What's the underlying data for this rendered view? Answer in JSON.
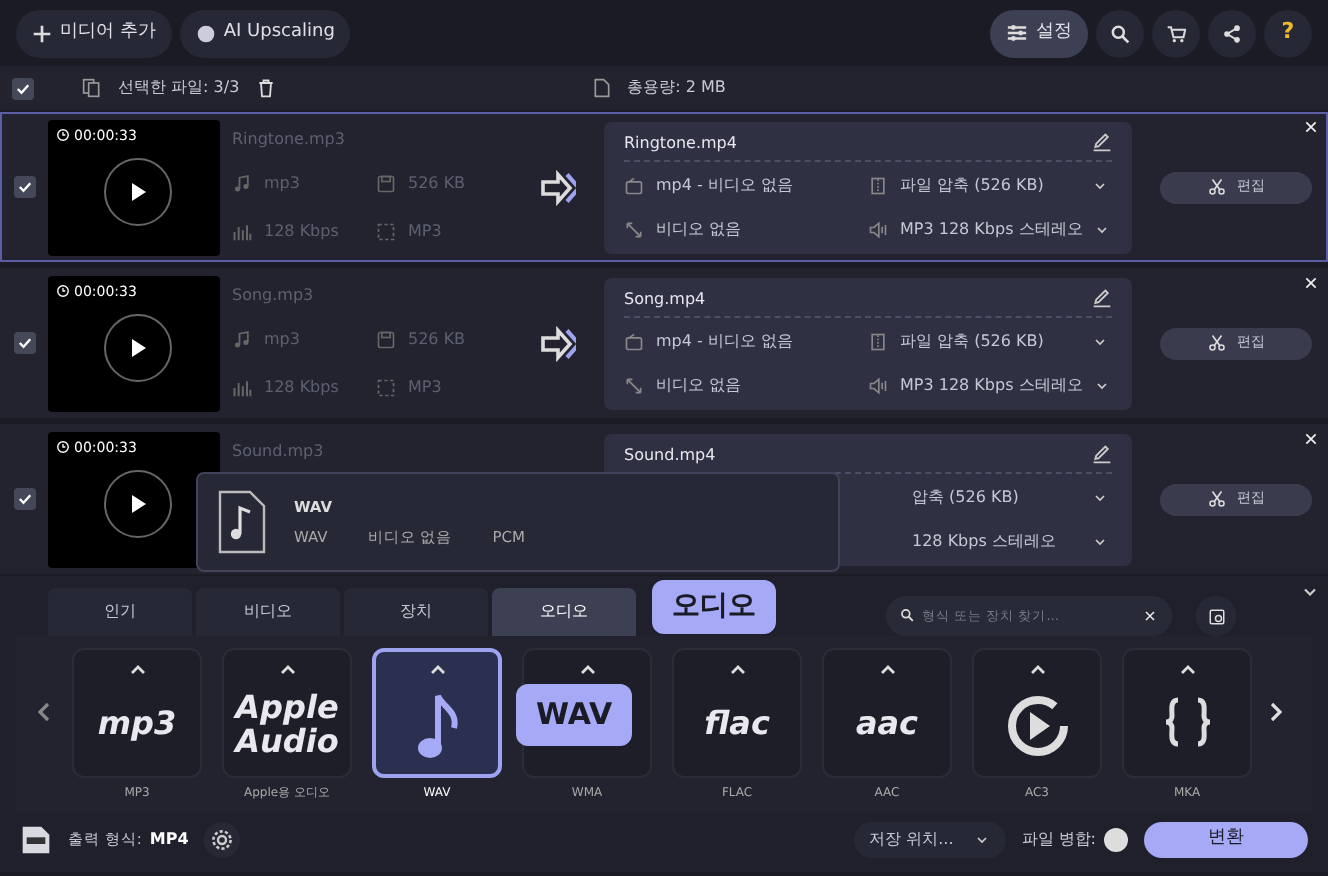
{
  "toolbar": {
    "add_media": "미디어 추가",
    "ai_upscaling": "AI Upscaling",
    "settings": "설정",
    "settings_selected": true,
    "help": "?"
  },
  "selection": {
    "checked": true,
    "selected_files": "선택한 파일: 3/3",
    "total_size": "총용량: 2 MB"
  },
  "files": [
    {
      "checked": true,
      "selected": true,
      "duration": "00:00:33",
      "source": {
        "name": "Ringtone.mp3",
        "format": "mp3",
        "size": "526 KB",
        "bitrate": "128 Kbps",
        "codec": "MP3"
      },
      "output": {
        "name": "Ringtone.mp4",
        "fields": [
          {
            "kind": "container",
            "text": "mp4 - 비디오 없음"
          },
          {
            "kind": "compression",
            "text": "파일 압축 (526 KB)"
          },
          {
            "kind": "video",
            "text": "비디오 없음"
          },
          {
            "kind": "audio",
            "text": "MP3 128 Kbps 스테레오"
          }
        ]
      },
      "edit": "편집"
    },
    {
      "checked": true,
      "selected": false,
      "duration": "00:00:33",
      "source": {
        "name": "Song.mp3",
        "format": "mp3",
        "size": "526 KB",
        "bitrate": "128 Kbps",
        "codec": "MP3"
      },
      "output": {
        "name": "Song.mp4",
        "fields": [
          {
            "kind": "container",
            "text": "mp4 - 비디오 없음"
          },
          {
            "kind": "compression",
            "text": "파일 압축 (526 KB)"
          },
          {
            "kind": "video",
            "text": "비디오 없음"
          },
          {
            "kind": "audio",
            "text": "MP3 128 Kbps 스테레오"
          }
        ]
      },
      "edit": "편집"
    },
    {
      "checked": true,
      "selected": false,
      "duration": "00:00:33",
      "source": {
        "name": "Sound.mp3"
      },
      "output": {
        "name": "Sound.mp4",
        "fields": [
          {
            "kind": "hidden"
          },
          {
            "kind": "partial",
            "text": "압축 (526 KB)"
          },
          {
            "kind": "hidden"
          },
          {
            "kind": "partial",
            "text": "128 Kbps 스테레오"
          }
        ]
      },
      "edit": "편집"
    }
  ],
  "format_popup": {
    "title": "WAV",
    "details": [
      "WAV",
      "비디오 없음",
      "PCM"
    ]
  },
  "tabs": [
    {
      "label": "인기",
      "selected": false
    },
    {
      "label": "비디오",
      "selected": false
    },
    {
      "label": "장치",
      "selected": false
    },
    {
      "label": "오디오",
      "selected": true
    }
  ],
  "tab_tooltip": "오디오",
  "search": {
    "placeholder": "형식 또는 장치 찾기..."
  },
  "formats": [
    {
      "label": "MP3",
      "kind": "text",
      "logo_lines": [
        "mp3"
      ],
      "selected": false
    },
    {
      "label": "Apple용 오디오",
      "kind": "text",
      "logo_lines": [
        "Apple",
        "Audio"
      ],
      "selected": false
    },
    {
      "label": "WAV",
      "kind": "note",
      "selected": true
    },
    {
      "label": "WMA",
      "kind": "blank",
      "selected": false
    },
    {
      "label": "FLAC",
      "kind": "text",
      "logo_lines": [
        "flac"
      ],
      "selected": false
    },
    {
      "label": "AAC",
      "kind": "text",
      "logo_lines": [
        "aac"
      ],
      "selected": false
    },
    {
      "label": "AC3",
      "kind": "play",
      "selected": false
    },
    {
      "label": "MKA",
      "kind": "braces",
      "selected": false
    }
  ],
  "format_tooltip": "WAV",
  "footer": {
    "output_label": "출력 형식:",
    "output_format": "MP4",
    "save_location": "저장 위치...",
    "merge_label": "파일 병합:",
    "merge_on": false,
    "convert": "변환"
  }
}
